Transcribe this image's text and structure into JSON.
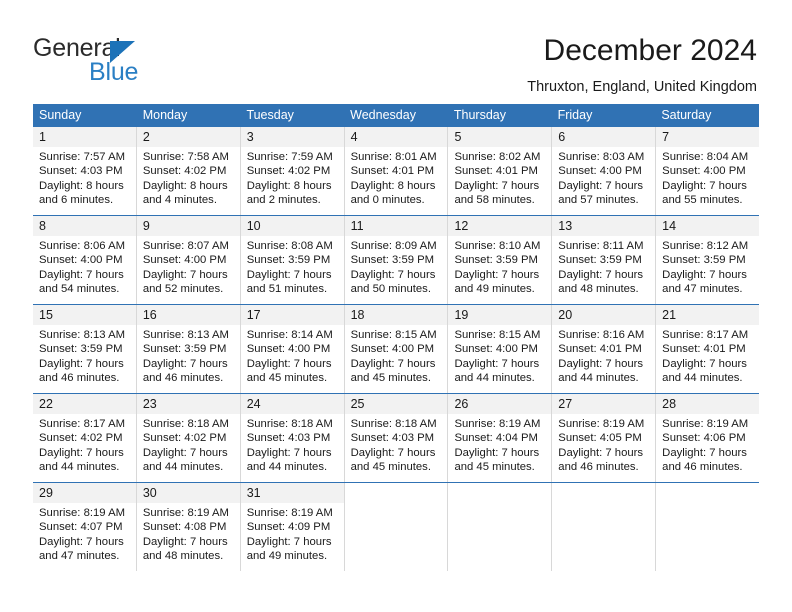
{
  "brand": {
    "name_part1": "General",
    "name_part2": "Blue",
    "triangle_color": "#1c72b8",
    "blue_color": "#2a7fc4"
  },
  "header": {
    "title": "December 2024",
    "location": "Thruxton, England, United Kingdom"
  },
  "theme": {
    "header_blue": "#3072b4",
    "daynum_bg": "#f2f2f2",
    "cell_border": "#d8d8d8"
  },
  "weekdays": [
    "Sunday",
    "Monday",
    "Tuesday",
    "Wednesday",
    "Thursday",
    "Friday",
    "Saturday"
  ],
  "weeks": [
    [
      {
        "day": "1",
        "sunrise": "Sunrise: 7:57 AM",
        "sunset": "Sunset: 4:03 PM",
        "daylight1": "Daylight: 8 hours",
        "daylight2": "and 6 minutes."
      },
      {
        "day": "2",
        "sunrise": "Sunrise: 7:58 AM",
        "sunset": "Sunset: 4:02 PM",
        "daylight1": "Daylight: 8 hours",
        "daylight2": "and 4 minutes."
      },
      {
        "day": "3",
        "sunrise": "Sunrise: 7:59 AM",
        "sunset": "Sunset: 4:02 PM",
        "daylight1": "Daylight: 8 hours",
        "daylight2": "and 2 minutes."
      },
      {
        "day": "4",
        "sunrise": "Sunrise: 8:01 AM",
        "sunset": "Sunset: 4:01 PM",
        "daylight1": "Daylight: 8 hours",
        "daylight2": "and 0 minutes."
      },
      {
        "day": "5",
        "sunrise": "Sunrise: 8:02 AM",
        "sunset": "Sunset: 4:01 PM",
        "daylight1": "Daylight: 7 hours",
        "daylight2": "and 58 minutes."
      },
      {
        "day": "6",
        "sunrise": "Sunrise: 8:03 AM",
        "sunset": "Sunset: 4:00 PM",
        "daylight1": "Daylight: 7 hours",
        "daylight2": "and 57 minutes."
      },
      {
        "day": "7",
        "sunrise": "Sunrise: 8:04 AM",
        "sunset": "Sunset: 4:00 PM",
        "daylight1": "Daylight: 7 hours",
        "daylight2": "and 55 minutes."
      }
    ],
    [
      {
        "day": "8",
        "sunrise": "Sunrise: 8:06 AM",
        "sunset": "Sunset: 4:00 PM",
        "daylight1": "Daylight: 7 hours",
        "daylight2": "and 54 minutes."
      },
      {
        "day": "9",
        "sunrise": "Sunrise: 8:07 AM",
        "sunset": "Sunset: 4:00 PM",
        "daylight1": "Daylight: 7 hours",
        "daylight2": "and 52 minutes."
      },
      {
        "day": "10",
        "sunrise": "Sunrise: 8:08 AM",
        "sunset": "Sunset: 3:59 PM",
        "daylight1": "Daylight: 7 hours",
        "daylight2": "and 51 minutes."
      },
      {
        "day": "11",
        "sunrise": "Sunrise: 8:09 AM",
        "sunset": "Sunset: 3:59 PM",
        "daylight1": "Daylight: 7 hours",
        "daylight2": "and 50 minutes."
      },
      {
        "day": "12",
        "sunrise": "Sunrise: 8:10 AM",
        "sunset": "Sunset: 3:59 PM",
        "daylight1": "Daylight: 7 hours",
        "daylight2": "and 49 minutes."
      },
      {
        "day": "13",
        "sunrise": "Sunrise: 8:11 AM",
        "sunset": "Sunset: 3:59 PM",
        "daylight1": "Daylight: 7 hours",
        "daylight2": "and 48 minutes."
      },
      {
        "day": "14",
        "sunrise": "Sunrise: 8:12 AM",
        "sunset": "Sunset: 3:59 PM",
        "daylight1": "Daylight: 7 hours",
        "daylight2": "and 47 minutes."
      }
    ],
    [
      {
        "day": "15",
        "sunrise": "Sunrise: 8:13 AM",
        "sunset": "Sunset: 3:59 PM",
        "daylight1": "Daylight: 7 hours",
        "daylight2": "and 46 minutes."
      },
      {
        "day": "16",
        "sunrise": "Sunrise: 8:13 AM",
        "sunset": "Sunset: 3:59 PM",
        "daylight1": "Daylight: 7 hours",
        "daylight2": "and 46 minutes."
      },
      {
        "day": "17",
        "sunrise": "Sunrise: 8:14 AM",
        "sunset": "Sunset: 4:00 PM",
        "daylight1": "Daylight: 7 hours",
        "daylight2": "and 45 minutes."
      },
      {
        "day": "18",
        "sunrise": "Sunrise: 8:15 AM",
        "sunset": "Sunset: 4:00 PM",
        "daylight1": "Daylight: 7 hours",
        "daylight2": "and 45 minutes."
      },
      {
        "day": "19",
        "sunrise": "Sunrise: 8:15 AM",
        "sunset": "Sunset: 4:00 PM",
        "daylight1": "Daylight: 7 hours",
        "daylight2": "and 44 minutes."
      },
      {
        "day": "20",
        "sunrise": "Sunrise: 8:16 AM",
        "sunset": "Sunset: 4:01 PM",
        "daylight1": "Daylight: 7 hours",
        "daylight2": "and 44 minutes."
      },
      {
        "day": "21",
        "sunrise": "Sunrise: 8:17 AM",
        "sunset": "Sunset: 4:01 PM",
        "daylight1": "Daylight: 7 hours",
        "daylight2": "and 44 minutes."
      }
    ],
    [
      {
        "day": "22",
        "sunrise": "Sunrise: 8:17 AM",
        "sunset": "Sunset: 4:02 PM",
        "daylight1": "Daylight: 7 hours",
        "daylight2": "and 44 minutes."
      },
      {
        "day": "23",
        "sunrise": "Sunrise: 8:18 AM",
        "sunset": "Sunset: 4:02 PM",
        "daylight1": "Daylight: 7 hours",
        "daylight2": "and 44 minutes."
      },
      {
        "day": "24",
        "sunrise": "Sunrise: 8:18 AM",
        "sunset": "Sunset: 4:03 PM",
        "daylight1": "Daylight: 7 hours",
        "daylight2": "and 44 minutes."
      },
      {
        "day": "25",
        "sunrise": "Sunrise: 8:18 AM",
        "sunset": "Sunset: 4:03 PM",
        "daylight1": "Daylight: 7 hours",
        "daylight2": "and 45 minutes."
      },
      {
        "day": "26",
        "sunrise": "Sunrise: 8:19 AM",
        "sunset": "Sunset: 4:04 PM",
        "daylight1": "Daylight: 7 hours",
        "daylight2": "and 45 minutes."
      },
      {
        "day": "27",
        "sunrise": "Sunrise: 8:19 AM",
        "sunset": "Sunset: 4:05 PM",
        "daylight1": "Daylight: 7 hours",
        "daylight2": "and 46 minutes."
      },
      {
        "day": "28",
        "sunrise": "Sunrise: 8:19 AM",
        "sunset": "Sunset: 4:06 PM",
        "daylight1": "Daylight: 7 hours",
        "daylight2": "and 46 minutes."
      }
    ],
    [
      {
        "day": "29",
        "sunrise": "Sunrise: 8:19 AM",
        "sunset": "Sunset: 4:07 PM",
        "daylight1": "Daylight: 7 hours",
        "daylight2": "and 47 minutes."
      },
      {
        "day": "30",
        "sunrise": "Sunrise: 8:19 AM",
        "sunset": "Sunset: 4:08 PM",
        "daylight1": "Daylight: 7 hours",
        "daylight2": "and 48 minutes."
      },
      {
        "day": "31",
        "sunrise": "Sunrise: 8:19 AM",
        "sunset": "Sunset: 4:09 PM",
        "daylight1": "Daylight: 7 hours",
        "daylight2": "and 49 minutes."
      },
      {
        "day": "",
        "sunrise": "",
        "sunset": "",
        "daylight1": "",
        "daylight2": ""
      },
      {
        "day": "",
        "sunrise": "",
        "sunset": "",
        "daylight1": "",
        "daylight2": ""
      },
      {
        "day": "",
        "sunrise": "",
        "sunset": "",
        "daylight1": "",
        "daylight2": ""
      },
      {
        "day": "",
        "sunrise": "",
        "sunset": "",
        "daylight1": "",
        "daylight2": ""
      }
    ]
  ]
}
